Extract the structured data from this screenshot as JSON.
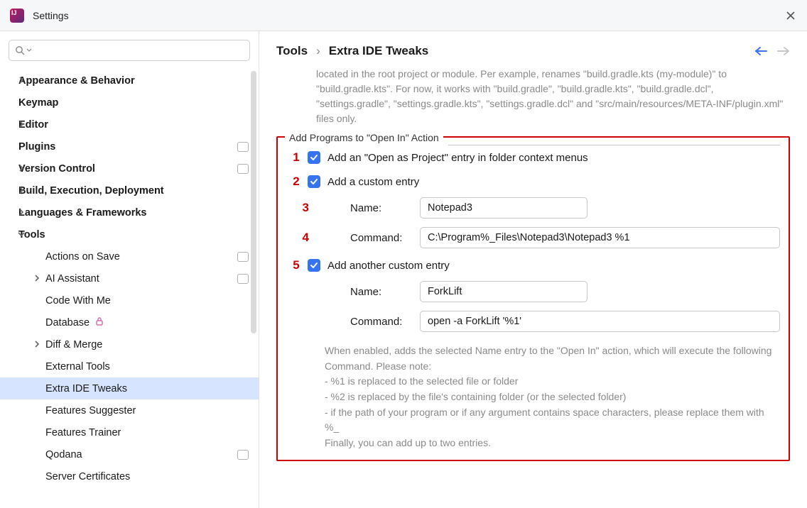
{
  "titlebar": {
    "title": "Settings"
  },
  "sidebar": {
    "items": [
      {
        "label": "Appearance & Behavior",
        "arrow": true,
        "top": true
      },
      {
        "label": "Keymap",
        "top": true
      },
      {
        "label": "Editor",
        "arrow": true,
        "top": true
      },
      {
        "label": "Plugins",
        "top": true,
        "badge": true
      },
      {
        "label": "Version Control",
        "arrow": true,
        "top": true,
        "badge": true
      },
      {
        "label": "Build, Execution, Deployment",
        "arrow": true,
        "top": true
      },
      {
        "label": "Languages & Frameworks",
        "arrow": true,
        "top": true
      },
      {
        "label": "Tools",
        "arrow": true,
        "expanded": true,
        "top": true
      },
      {
        "label": "Actions on Save",
        "child": true,
        "badge": true
      },
      {
        "label": "AI Assistant",
        "child": true,
        "arrow": true,
        "badge": true
      },
      {
        "label": "Code With Me",
        "child": true
      },
      {
        "label": "Database",
        "child": true,
        "lock": true
      },
      {
        "label": "Diff & Merge",
        "child": true,
        "arrow": true
      },
      {
        "label": "External Tools",
        "child": true
      },
      {
        "label": "Extra IDE Tweaks",
        "child": true,
        "selected": true
      },
      {
        "label": "Features Suggester",
        "child": true
      },
      {
        "label": "Features Trainer",
        "child": true
      },
      {
        "label": "Qodana",
        "child": true,
        "badge": true
      },
      {
        "label": "Server Certificates",
        "child": true
      }
    ]
  },
  "breadcrumb": {
    "root": "Tools",
    "leaf": "Extra IDE Tweaks"
  },
  "intro": "located in the root project or module. Per example, renames \"build.gradle.kts (my-module)\" to \"build.gradle.kts\". For now, it works with \"build.gradle\", \"build.gradle.kts\", \"build.gradle.dcl\", \"settings.gradle\", \"settings.gradle.kts\", \"settings.gradle.dcl\" and \"src/main/resources/META-INF/plugin.xml\" files only.",
  "section": {
    "legend": "Add Programs to \"Open In\" Action",
    "markers": {
      "m1": "1",
      "m2": "2",
      "m3": "3",
      "m4": "4",
      "m5": "5"
    },
    "cb1_label": "Add an \"Open as Project\" entry in folder context menus",
    "cb2_label": "Add a custom entry",
    "name_label": "Name:",
    "command_label": "Command:",
    "entry1": {
      "name": "Notepad3",
      "command": "C:\\Program%_Files\\Notepad3\\Notepad3 %1"
    },
    "cb3_label": "Add another custom entry",
    "entry2": {
      "name": "ForkLift",
      "command": "open -a ForkLift '%1'"
    },
    "help": "When enabled, adds the selected Name entry to the \"Open In\" action, which will execute the following Command. Please note:\n- %1 is replaced to the selected file or folder\n- %2 is replaced by the file's containing folder (or the selected folder)\n- if the path of your program or if any argument contains space characters, please replace them with %_\nFinally, you can add up to two entries."
  }
}
